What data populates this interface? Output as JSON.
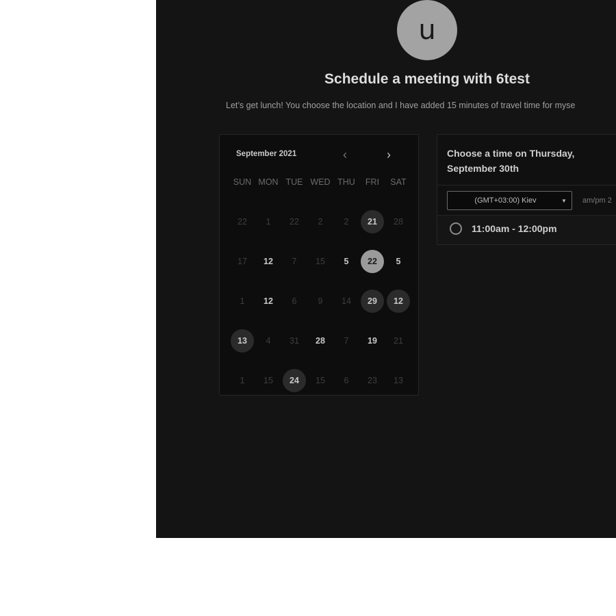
{
  "host": {
    "avatar_letter": "u",
    "title": "Schedule a meeting with 6test",
    "description": "Let’s get lunch! You choose the location and I have added 15 minutes of travel time for myse"
  },
  "calendar": {
    "month_label": "September 2021",
    "prev_icon": "chevron-left-icon",
    "next_icon": "chevron-right-icon",
    "weekdays": [
      "SUN",
      "MON",
      "TUE",
      "WED",
      "THU",
      "FRI",
      "SAT"
    ],
    "weeks": [
      [
        "22",
        "1",
        "22",
        "2",
        "2",
        "21",
        "28"
      ],
      [
        "17",
        "12",
        "7",
        "15",
        "5",
        "22",
        "5"
      ],
      [
        "1",
        "12",
        "6",
        "9",
        "14",
        "29",
        "12"
      ],
      [
        "13",
        "4",
        "31",
        "28",
        "7",
        "19",
        "21"
      ],
      [
        "1",
        "15",
        "24",
        "15",
        "6",
        "23",
        "13"
      ]
    ],
    "selected_date": "22"
  },
  "time_picker": {
    "heading": "Choose a time on Thursday, September 30th",
    "timezone": "(GMT+03:00) Kiev",
    "format_label": "am/pm  2",
    "slots": [
      "11:00am - 12:00pm"
    ]
  },
  "colors": {
    "background": "#141414",
    "selected_day": "#9b9b9b",
    "available_day": "#2b2b2b"
  }
}
